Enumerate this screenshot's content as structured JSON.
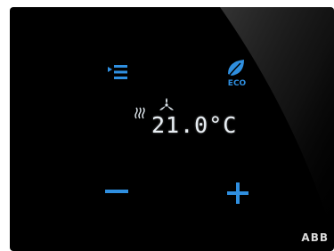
{
  "display": {
    "temperature": "21.0°C",
    "heating_icon": "heating-waves-icon",
    "fan_icon": "fan-icon"
  },
  "controls": {
    "menu_icon": "menu-list-icon",
    "eco_label": "ECO",
    "eco_icon": "leaf-icon",
    "minus_icon": "minus-icon",
    "plus_icon": "plus-icon"
  },
  "brand": "ABB",
  "colors": {
    "accent": "#2f8fe0",
    "panel": "#000000",
    "readout": "#e8eef3"
  }
}
